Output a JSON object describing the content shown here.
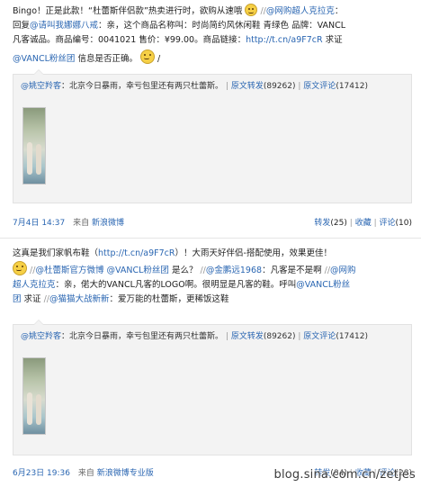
{
  "post1": {
    "l1_a": "Bingo！正是此款！“杜蕾斯伴侣款”热卖进行时，欲购从速哦",
    "l1_slashes": "//",
    "l1_mention": "@网购超人克拉克",
    "l1_colon": "：",
    "l2_a": "回复",
    "l2_mention": "@请叫我娜娜八戒",
    "l2_b": "：亲，这个商品名称叫：时尚简约风休闲鞋 青绿色 品牌：VANCL",
    "l3_a": "凡客诚品。商品编号：0041021 售价：¥99.00。商品链接：",
    "l3_link": "http://t.cn/a9F7cR",
    "l3_b": " 求证",
    "l4_mention": "@VANCL粉丝团",
    "l4_b": " 信息是否正确。",
    "l4_tail": "/",
    "quote": {
      "mention": "@姚空羚客",
      "text": "：北京今日暴雨，幸亏包里还有两只杜蕾斯。",
      "forward": "原文转发",
      "forward_count": "(89262)",
      "comment": "原文评论",
      "comment_count": "(17412)"
    },
    "time": "7月4日 14:37",
    "from_label": "来自",
    "source": "新浪微博",
    "forward": "转发",
    "forward_count": "(25)",
    "favorite": "收藏",
    "comment": "评论",
    "comment_count": "(10)"
  },
  "post2": {
    "l1_a": "这真是我们家帆布鞋（",
    "l1_link": "http://t.cn/a9F7cR",
    "l1_b": "）！大雨天好伴侣-搭配使用，效果更佳！",
    "l2_slashes": "//",
    "l2_mention1": "@杜蕾斯官方微博",
    "l2_mention2": "@VANCL粉丝团",
    "l2_a": " 是么？",
    "l2_slashes2": "//",
    "l2_mention3": "@金鹏远1968",
    "l2_b": "：凡客是不是啊",
    "l2_slashes3": "//",
    "l2_mention4": "@网购",
    "l3_mention": "超人克拉克",
    "l3_a": "：亲，偌大的VANCL凡客的LOGO啊。很明显是凡客的鞋。呼叫",
    "l3_mention2": "@VANCL粉丝",
    "l4_mention": "团",
    "l4_a": " 求证 ",
    "l4_slashes": "//",
    "l4_mention2": "@猫猫大战新新",
    "l4_b": "：爱万能的杜蕾斯，更稀饭这鞋",
    "quote": {
      "mention": "@姚空羚客",
      "text": "：北京今日暴雨，幸亏包里还有两只杜蕾斯。",
      "forward": "原文转发",
      "forward_count": "(89262)",
      "comment": "原文评论",
      "comment_count": "(17412)"
    },
    "time": "6月23日 19:36",
    "from_label": "来自",
    "source": "新浪微博专业版",
    "forward": "转发",
    "forward_count": "(84)",
    "favorite": "收藏",
    "comment": "评论",
    "comment_count": "(28)"
  },
  "watermark": "blog.sina.com.cn/zetjes"
}
